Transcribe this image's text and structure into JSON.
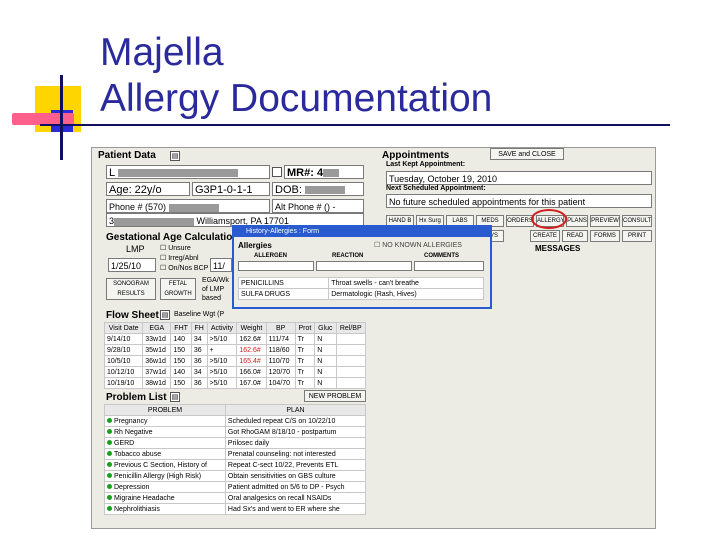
{
  "slide": {
    "title_line1": "Majella",
    "title_line2": "Allergy Documentation"
  },
  "patient": {
    "header": "Patient Data",
    "name_prefix": "L",
    "mr_label": "MR#: 4",
    "age": "Age: 22y/o",
    "gpa": "G3P1-0-1-1",
    "dob_label": "DOB:",
    "phone": "Phone # (570)",
    "alt_phone": "Alt Phone # () -",
    "address_prefix": "3",
    "city": "Williamsport, PA 17701"
  },
  "appointments": {
    "header": "Appointments",
    "save_close": "SAVE and CLOSE",
    "last_label": "Last Kept Appointment:",
    "last_value": "Tuesday, October 19, 2010",
    "next_label": "Next Scheduled Appointment:",
    "next_value": "No future scheduled appointments for this patient",
    "row1": [
      "HAND B",
      "Hx Surg",
      "LABS",
      "MEDS",
      "ORDERS",
      "ALLERGY",
      "PLANS",
      "PREVIEW",
      "CONSULT"
    ],
    "row2": [
      "",
      "NAVS",
      "CREATE",
      "READ",
      "FORMS",
      "PRINT"
    ],
    "messages": "MESSAGES"
  },
  "gestational": {
    "header": "Gestational Age Calculation",
    "lmp_label": "LMP",
    "lmp_value": "1/25/10",
    "checks": [
      "Unsure",
      "Irreg/Abnl",
      "On/Nos BCP"
    ],
    "edc_value": "11/",
    "sonogram": "SONOGRAM RESULTS",
    "fetal": "FETAL GROWTH",
    "notes": [
      "EGA/Wk",
      "of LMP",
      "based"
    ]
  },
  "flow": {
    "header": "Flow Sheet",
    "baseline": "Baseline Wgt (P",
    "columns": [
      "Visit Date",
      "EGA",
      "FHT",
      "FH",
      "Activity",
      "Weight",
      "BP",
      "Prot",
      "Gluc",
      "Rel/BP"
    ],
    "rows": [
      [
        "9/14/10",
        "33w1d",
        "140",
        "34",
        ">5/10",
        "162.6#",
        "111/74",
        "Tr",
        "N",
        ""
      ],
      [
        "9/28/10",
        "35w1d",
        "150",
        "36",
        "+",
        "162.6#",
        "118/60",
        "Tr",
        "N",
        ""
      ],
      [
        "10/5/10",
        "36w1d",
        "150",
        "36",
        ">5/10",
        "165.4#",
        "110/70",
        "Tr",
        "N",
        ""
      ],
      [
        "10/12/10",
        "37w1d",
        "140",
        "34",
        ">5/10",
        "166.0#",
        "120/70",
        "Tr",
        "N",
        ""
      ],
      [
        "10/19/10",
        "38w1d",
        "150",
        "36",
        ">5/10",
        "167.0#",
        "104/70",
        "Tr",
        "N",
        ""
      ]
    ],
    "red_rows": [
      1,
      2
    ]
  },
  "problems": {
    "header": "Problem List",
    "new_problem": "NEW PROBLEM",
    "columns": [
      "PROBLEM",
      "PLAN"
    ],
    "rows": [
      [
        "Pregnancy",
        "Scheduled repeat C/S on 10/22/10"
      ],
      [
        "Rh Negative",
        "Got RhoGAM 8/18/10 - postpartum"
      ],
      [
        "GERD",
        "Prilosec daily"
      ],
      [
        "Tobacco abuse",
        "Prenatal counseling: not interested"
      ],
      [
        "Previous C Section, History of",
        "Repeat C-sect 10/22, Prevents ETL"
      ],
      [
        "Penicillin Allergy (High Risk)",
        "Obtain sensitivities on GBS culture"
      ],
      [
        "Depression",
        "Patient admitted on 5/6 to DP - Psych"
      ],
      [
        "Migraine Headache",
        "Oral analgesics on recall NSAIDs"
      ],
      [
        "Nephrolithiasis",
        "Had Sx's and went to ER where she"
      ]
    ]
  },
  "modal": {
    "title": "History-Allergies : Form",
    "allergies_label": "Allergies",
    "no_known": "NO KNOWN ALLERGIES",
    "columns": [
      "ALLERGEN",
      "REACTION",
      "COMMENTS"
    ],
    "rows": [
      [
        "PENICILLINS",
        "Throat swells - can't breathe"
      ],
      [
        "SULFA DRUGS",
        "Dermatologic (Rash, Hives)"
      ]
    ]
  }
}
